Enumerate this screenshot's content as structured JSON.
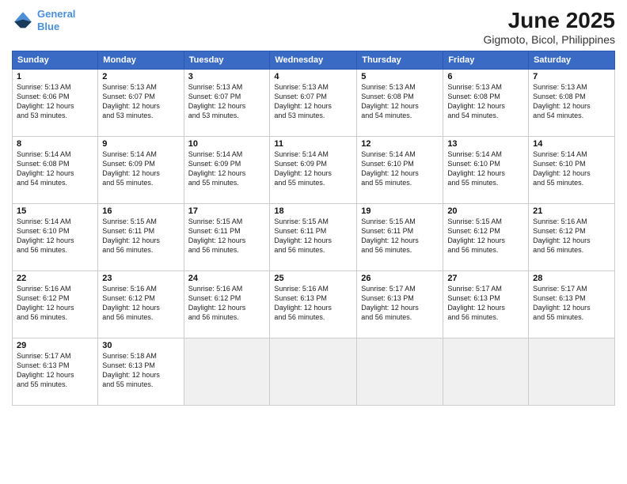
{
  "logo": {
    "line1": "General",
    "line2": "Blue"
  },
  "title": "June 2025",
  "subtitle": "Gigmoto, Bicol, Philippines",
  "headers": [
    "Sunday",
    "Monday",
    "Tuesday",
    "Wednesday",
    "Thursday",
    "Friday",
    "Saturday"
  ],
  "weeks": [
    [
      {
        "day": "1",
        "rise": "5:13 AM",
        "set": "6:06 PM",
        "daylight": "12 hours and 53 minutes."
      },
      {
        "day": "2",
        "rise": "5:13 AM",
        "set": "6:07 PM",
        "daylight": "12 hours and 53 minutes."
      },
      {
        "day": "3",
        "rise": "5:13 AM",
        "set": "6:07 PM",
        "daylight": "12 hours and 53 minutes."
      },
      {
        "day": "4",
        "rise": "5:13 AM",
        "set": "6:07 PM",
        "daylight": "12 hours and 53 minutes."
      },
      {
        "day": "5",
        "rise": "5:13 AM",
        "set": "6:08 PM",
        "daylight": "12 hours and 54 minutes."
      },
      {
        "day": "6",
        "rise": "5:13 AM",
        "set": "6:08 PM",
        "daylight": "12 hours and 54 minutes."
      },
      {
        "day": "7",
        "rise": "5:13 AM",
        "set": "6:08 PM",
        "daylight": "12 hours and 54 minutes."
      }
    ],
    [
      {
        "day": "8",
        "rise": "5:14 AM",
        "set": "6:08 PM",
        "daylight": "12 hours and 54 minutes."
      },
      {
        "day": "9",
        "rise": "5:14 AM",
        "set": "6:09 PM",
        "daylight": "12 hours and 55 minutes."
      },
      {
        "day": "10",
        "rise": "5:14 AM",
        "set": "6:09 PM",
        "daylight": "12 hours and 55 minutes."
      },
      {
        "day": "11",
        "rise": "5:14 AM",
        "set": "6:09 PM",
        "daylight": "12 hours and 55 minutes."
      },
      {
        "day": "12",
        "rise": "5:14 AM",
        "set": "6:10 PM",
        "daylight": "12 hours and 55 minutes."
      },
      {
        "day": "13",
        "rise": "5:14 AM",
        "set": "6:10 PM",
        "daylight": "12 hours and 55 minutes."
      },
      {
        "day": "14",
        "rise": "5:14 AM",
        "set": "6:10 PM",
        "daylight": "12 hours and 55 minutes."
      }
    ],
    [
      {
        "day": "15",
        "rise": "5:14 AM",
        "set": "6:10 PM",
        "daylight": "12 hours and 56 minutes."
      },
      {
        "day": "16",
        "rise": "5:15 AM",
        "set": "6:11 PM",
        "daylight": "12 hours and 56 minutes."
      },
      {
        "day": "17",
        "rise": "5:15 AM",
        "set": "6:11 PM",
        "daylight": "12 hours and 56 minutes."
      },
      {
        "day": "18",
        "rise": "5:15 AM",
        "set": "6:11 PM",
        "daylight": "12 hours and 56 minutes."
      },
      {
        "day": "19",
        "rise": "5:15 AM",
        "set": "6:11 PM",
        "daylight": "12 hours and 56 minutes."
      },
      {
        "day": "20",
        "rise": "5:15 AM",
        "set": "6:12 PM",
        "daylight": "12 hours and 56 minutes."
      },
      {
        "day": "21",
        "rise": "5:16 AM",
        "set": "6:12 PM",
        "daylight": "12 hours and 56 minutes."
      }
    ],
    [
      {
        "day": "22",
        "rise": "5:16 AM",
        "set": "6:12 PM",
        "daylight": "12 hours and 56 minutes."
      },
      {
        "day": "23",
        "rise": "5:16 AM",
        "set": "6:12 PM",
        "daylight": "12 hours and 56 minutes."
      },
      {
        "day": "24",
        "rise": "5:16 AM",
        "set": "6:12 PM",
        "daylight": "12 hours and 56 minutes."
      },
      {
        "day": "25",
        "rise": "5:16 AM",
        "set": "6:13 PM",
        "daylight": "12 hours and 56 minutes."
      },
      {
        "day": "26",
        "rise": "5:17 AM",
        "set": "6:13 PM",
        "daylight": "12 hours and 56 minutes."
      },
      {
        "day": "27",
        "rise": "5:17 AM",
        "set": "6:13 PM",
        "daylight": "12 hours and 56 minutes."
      },
      {
        "day": "28",
        "rise": "5:17 AM",
        "set": "6:13 PM",
        "daylight": "12 hours and 55 minutes."
      }
    ],
    [
      {
        "day": "29",
        "rise": "5:17 AM",
        "set": "6:13 PM",
        "daylight": "12 hours and 55 minutes."
      },
      {
        "day": "30",
        "rise": "5:18 AM",
        "set": "6:13 PM",
        "daylight": "12 hours and 55 minutes."
      },
      {
        "day": "",
        "rise": "",
        "set": "",
        "daylight": ""
      },
      {
        "day": "",
        "rise": "",
        "set": "",
        "daylight": ""
      },
      {
        "day": "",
        "rise": "",
        "set": "",
        "daylight": ""
      },
      {
        "day": "",
        "rise": "",
        "set": "",
        "daylight": ""
      },
      {
        "day": "",
        "rise": "",
        "set": "",
        "daylight": ""
      }
    ]
  ]
}
